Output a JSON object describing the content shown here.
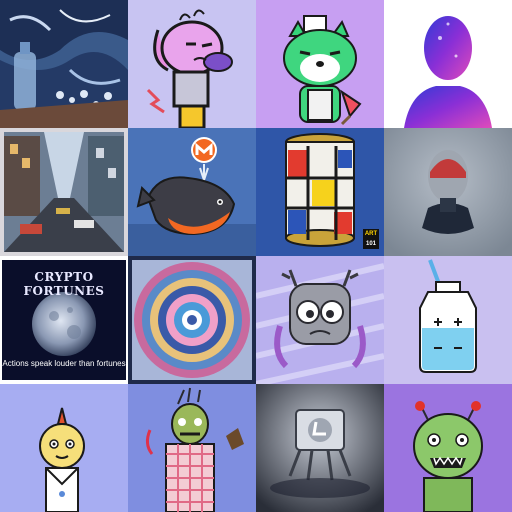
{
  "gallery": {
    "tiles": [
      {
        "name": "tile-abstract-bottle-painting",
        "bg": "#3a5a8a"
      },
      {
        "name": "tile-cartoon-dog-character",
        "bg": "#c8c4f2"
      },
      {
        "name": "tile-green-shiba-with-popsicle",
        "bg": "#c79ff2"
      },
      {
        "name": "tile-galaxy-head-silhouette",
        "bg": "#ffffff"
      },
      {
        "name": "tile-city-street-painting",
        "bg": "#4b5f74"
      },
      {
        "name": "tile-monero-whale",
        "bg": "#4a73b8"
      },
      {
        "name": "tile-mondrian-soup-can",
        "bg": "#2f56a8"
      },
      {
        "name": "tile-bust-sculpture-render",
        "bg": "#8e99a6"
      },
      {
        "name": "tile-crypto-fortunes-moon",
        "bg": "#0a0e2a"
      },
      {
        "name": "tile-mandala-pattern",
        "bg": "#a8b6d8"
      },
      {
        "name": "tile-grey-antler-monster",
        "bg": "#b9b0ee"
      },
      {
        "name": "tile-bottle-battery-icon",
        "bg": "#c9c0f0"
      },
      {
        "name": "tile-mohawk-cartoon-character",
        "bg": "#a7adf2"
      },
      {
        "name": "tile-zombie-chef-character",
        "bg": "#7f8ee0"
      },
      {
        "name": "tile-litecoin-robot-3d",
        "bg": "#6a6f7d"
      },
      {
        "name": "tile-green-zombie-character",
        "bg": "#9b74e0"
      }
    ]
  },
  "crypto_fortunes": {
    "title": "CRYPTO FORTUNES",
    "caption": "Actions speak louder than fortunes"
  },
  "mondrian": {
    "badge_top": "ART",
    "badge_bottom": "101"
  }
}
